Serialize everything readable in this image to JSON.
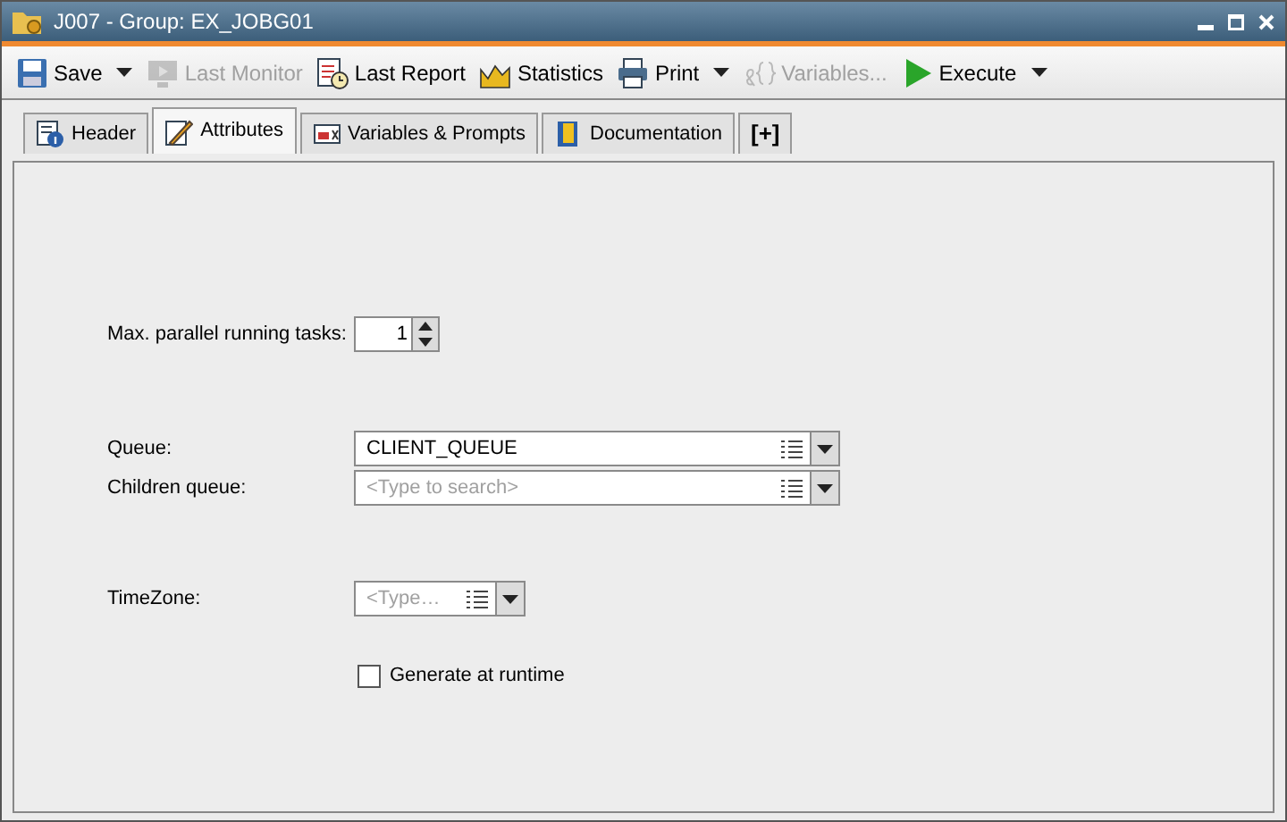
{
  "window": {
    "title": "J007 - Group: EX_JOBG01"
  },
  "toolbar": [
    {
      "label": "Save",
      "kind": "save",
      "disabled": false,
      "dropdown": true
    },
    {
      "label": "Last Monitor",
      "kind": "monitor",
      "disabled": true,
      "dropdown": false
    },
    {
      "label": "Last Report",
      "kind": "report",
      "disabled": false,
      "dropdown": false
    },
    {
      "label": "Statistics",
      "kind": "statistics",
      "disabled": false,
      "dropdown": false
    },
    {
      "label": "Print",
      "kind": "print",
      "disabled": false,
      "dropdown": true
    },
    {
      "label": "Variables...",
      "kind": "variables",
      "disabled": true,
      "dropdown": false
    },
    {
      "label": "Execute",
      "kind": "execute",
      "disabled": false,
      "dropdown": true
    }
  ],
  "tabs": [
    {
      "label": "Header",
      "kind": "header",
      "selected": false
    },
    {
      "label": "Attributes",
      "kind": "attributes",
      "selected": true
    },
    {
      "label": "Variables & Prompts",
      "kind": "variables",
      "selected": false
    },
    {
      "label": "Documentation",
      "kind": "documentation",
      "selected": false
    },
    {
      "label": "[+]",
      "kind": "add",
      "selected": false
    }
  ],
  "form": {
    "max_parallel": {
      "label": "Max. parallel running tasks:",
      "value": "1"
    },
    "queue": {
      "label": "Queue:",
      "value": "CLIENT_QUEUE"
    },
    "children_queue": {
      "label": "Children queue:",
      "placeholder": "<Type to search>"
    },
    "timezone": {
      "label": "TimeZone:",
      "placeholder": "<Type…"
    },
    "generate_at_runtime": {
      "label": "Generate at runtime",
      "checked": false
    }
  }
}
